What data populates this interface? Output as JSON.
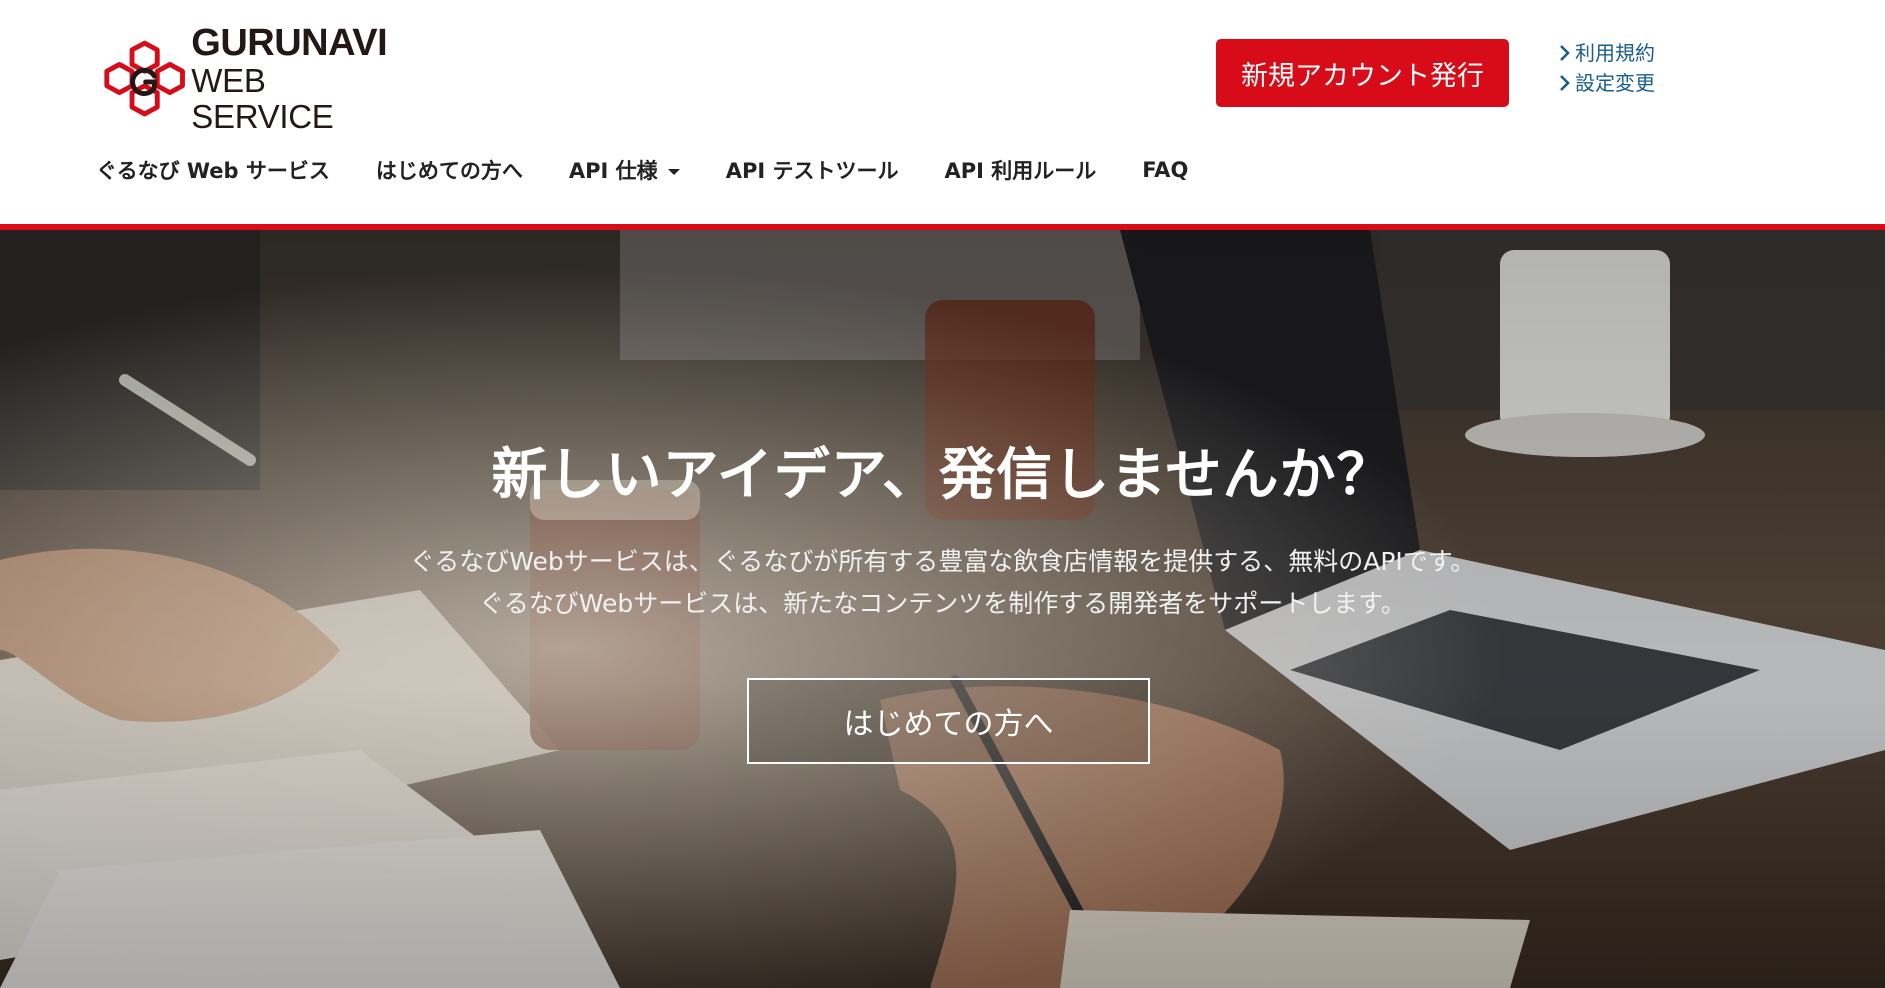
{
  "brand": {
    "line1": "GURUNAVI",
    "line2": "WEB SERVICE",
    "color": "#d70c18"
  },
  "header": {
    "signup_label": "新規アカウント発行",
    "links": [
      {
        "label": "利用規約",
        "icon": "chevron-right-icon"
      },
      {
        "label": "設定変更",
        "icon": "chevron-right-icon"
      }
    ]
  },
  "nav": {
    "items": [
      {
        "label": "ぐるなび Web サービス"
      },
      {
        "label": "はじめての方へ"
      },
      {
        "label": "API 仕様",
        "has_dropdown": true
      },
      {
        "label": "API テストツール"
      },
      {
        "label": "API 利用ルール"
      },
      {
        "label": "FAQ"
      }
    ]
  },
  "hero": {
    "title": "新しいアイデア、発信しませんか？",
    "subtitle_line1": "ぐるなびWebサービスは、ぐるなびが所有する豊富な飲食店情報を提供する、無料のAPIです。",
    "subtitle_line2": "ぐるなびWebサービスは、新たなコンテンツを制作する開発者をサポートします。",
    "cta_label": "はじめての方へ"
  },
  "colors": {
    "accent": "#d70c18",
    "link": "#1a5e8c"
  }
}
